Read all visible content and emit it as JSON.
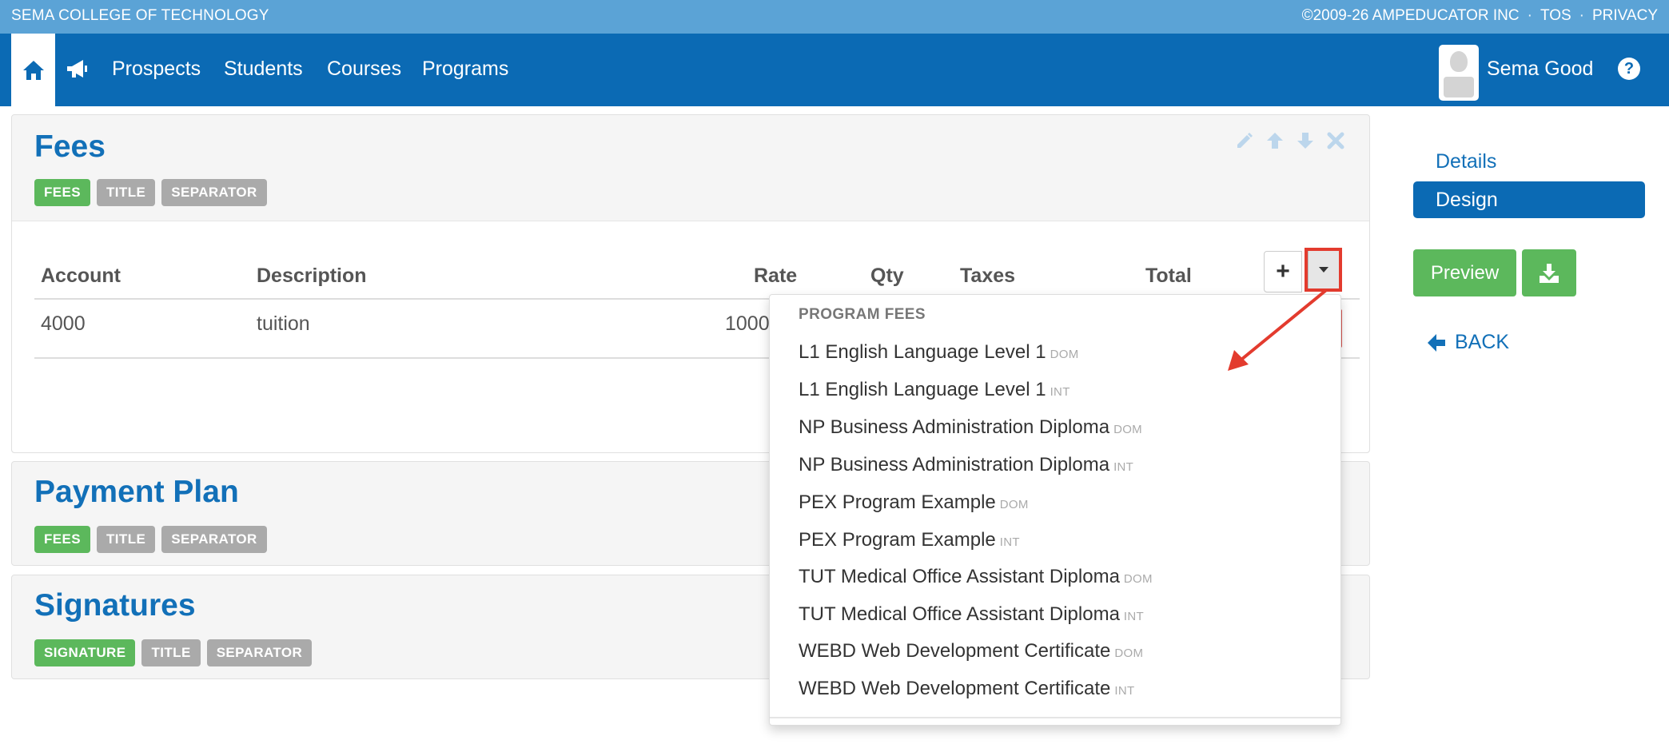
{
  "topbar": {
    "school": "SEMA COLLEGE OF TECHNOLOGY",
    "copyright": "©2009-26 AMPEDUCATOR INC",
    "sep": "·",
    "tos": "TOS",
    "privacy": "PRIVACY"
  },
  "nav": {
    "links": [
      "Prospects",
      "Students",
      "Courses",
      "Programs"
    ],
    "user": "Sema Good"
  },
  "panels": [
    {
      "title": "Fees",
      "tags": [
        "FEES",
        "TITLE",
        "SEPARATOR"
      ]
    },
    {
      "title": "Payment Plan",
      "tags": [
        "FEES",
        "TITLE",
        "SEPARATOR"
      ]
    },
    {
      "title": "Signatures",
      "tags": [
        "SIGNATURE",
        "TITLE",
        "SEPARATOR"
      ]
    }
  ],
  "fees_table": {
    "headers": [
      "Account",
      "Description",
      "Rate",
      "Qty",
      "Taxes",
      "Total"
    ],
    "row": [
      "4000",
      "tuition",
      "1000."
    ]
  },
  "dropdown": {
    "header": "PROGRAM FEES",
    "items": [
      {
        "label": "L1 English Language Level 1",
        "suffix": "DOM"
      },
      {
        "label": "L1 English Language Level 1",
        "suffix": "INT"
      },
      {
        "label": "NP Business Administration Diploma",
        "suffix": "DOM"
      },
      {
        "label": "NP Business Administration Diploma",
        "suffix": "INT"
      },
      {
        "label": "PEX Program Example",
        "suffix": "DOM"
      },
      {
        "label": "PEX Program Example",
        "suffix": "INT"
      },
      {
        "label": "TUT Medical Office Assistant Diploma",
        "suffix": "DOM"
      },
      {
        "label": "TUT Medical Office Assistant Diploma",
        "suffix": "INT"
      },
      {
        "label": "WEBD Web Development Certificate",
        "suffix": "DOM"
      },
      {
        "label": "WEBD Web Development Certificate",
        "suffix": "INT"
      }
    ]
  },
  "sidebar": {
    "details": "Details",
    "design": "Design",
    "preview": "Preview",
    "back": "BACK"
  },
  "icons": [
    "home-icon",
    "megaphone-icon",
    "help-icon",
    "pencil-icon",
    "arrow-up-icon",
    "arrow-down-icon",
    "close-icon",
    "plus-icon",
    "caret-down-icon",
    "download-icon",
    "arrow-left-icon"
  ],
  "colors": {
    "topbar": "#5ba3d6",
    "navbar": "#0b6ab4",
    "accent": "#1270b8",
    "green": "#5cb85c",
    "tag_gray": "#aaaaaa",
    "annotation": "#e33b2e"
  }
}
